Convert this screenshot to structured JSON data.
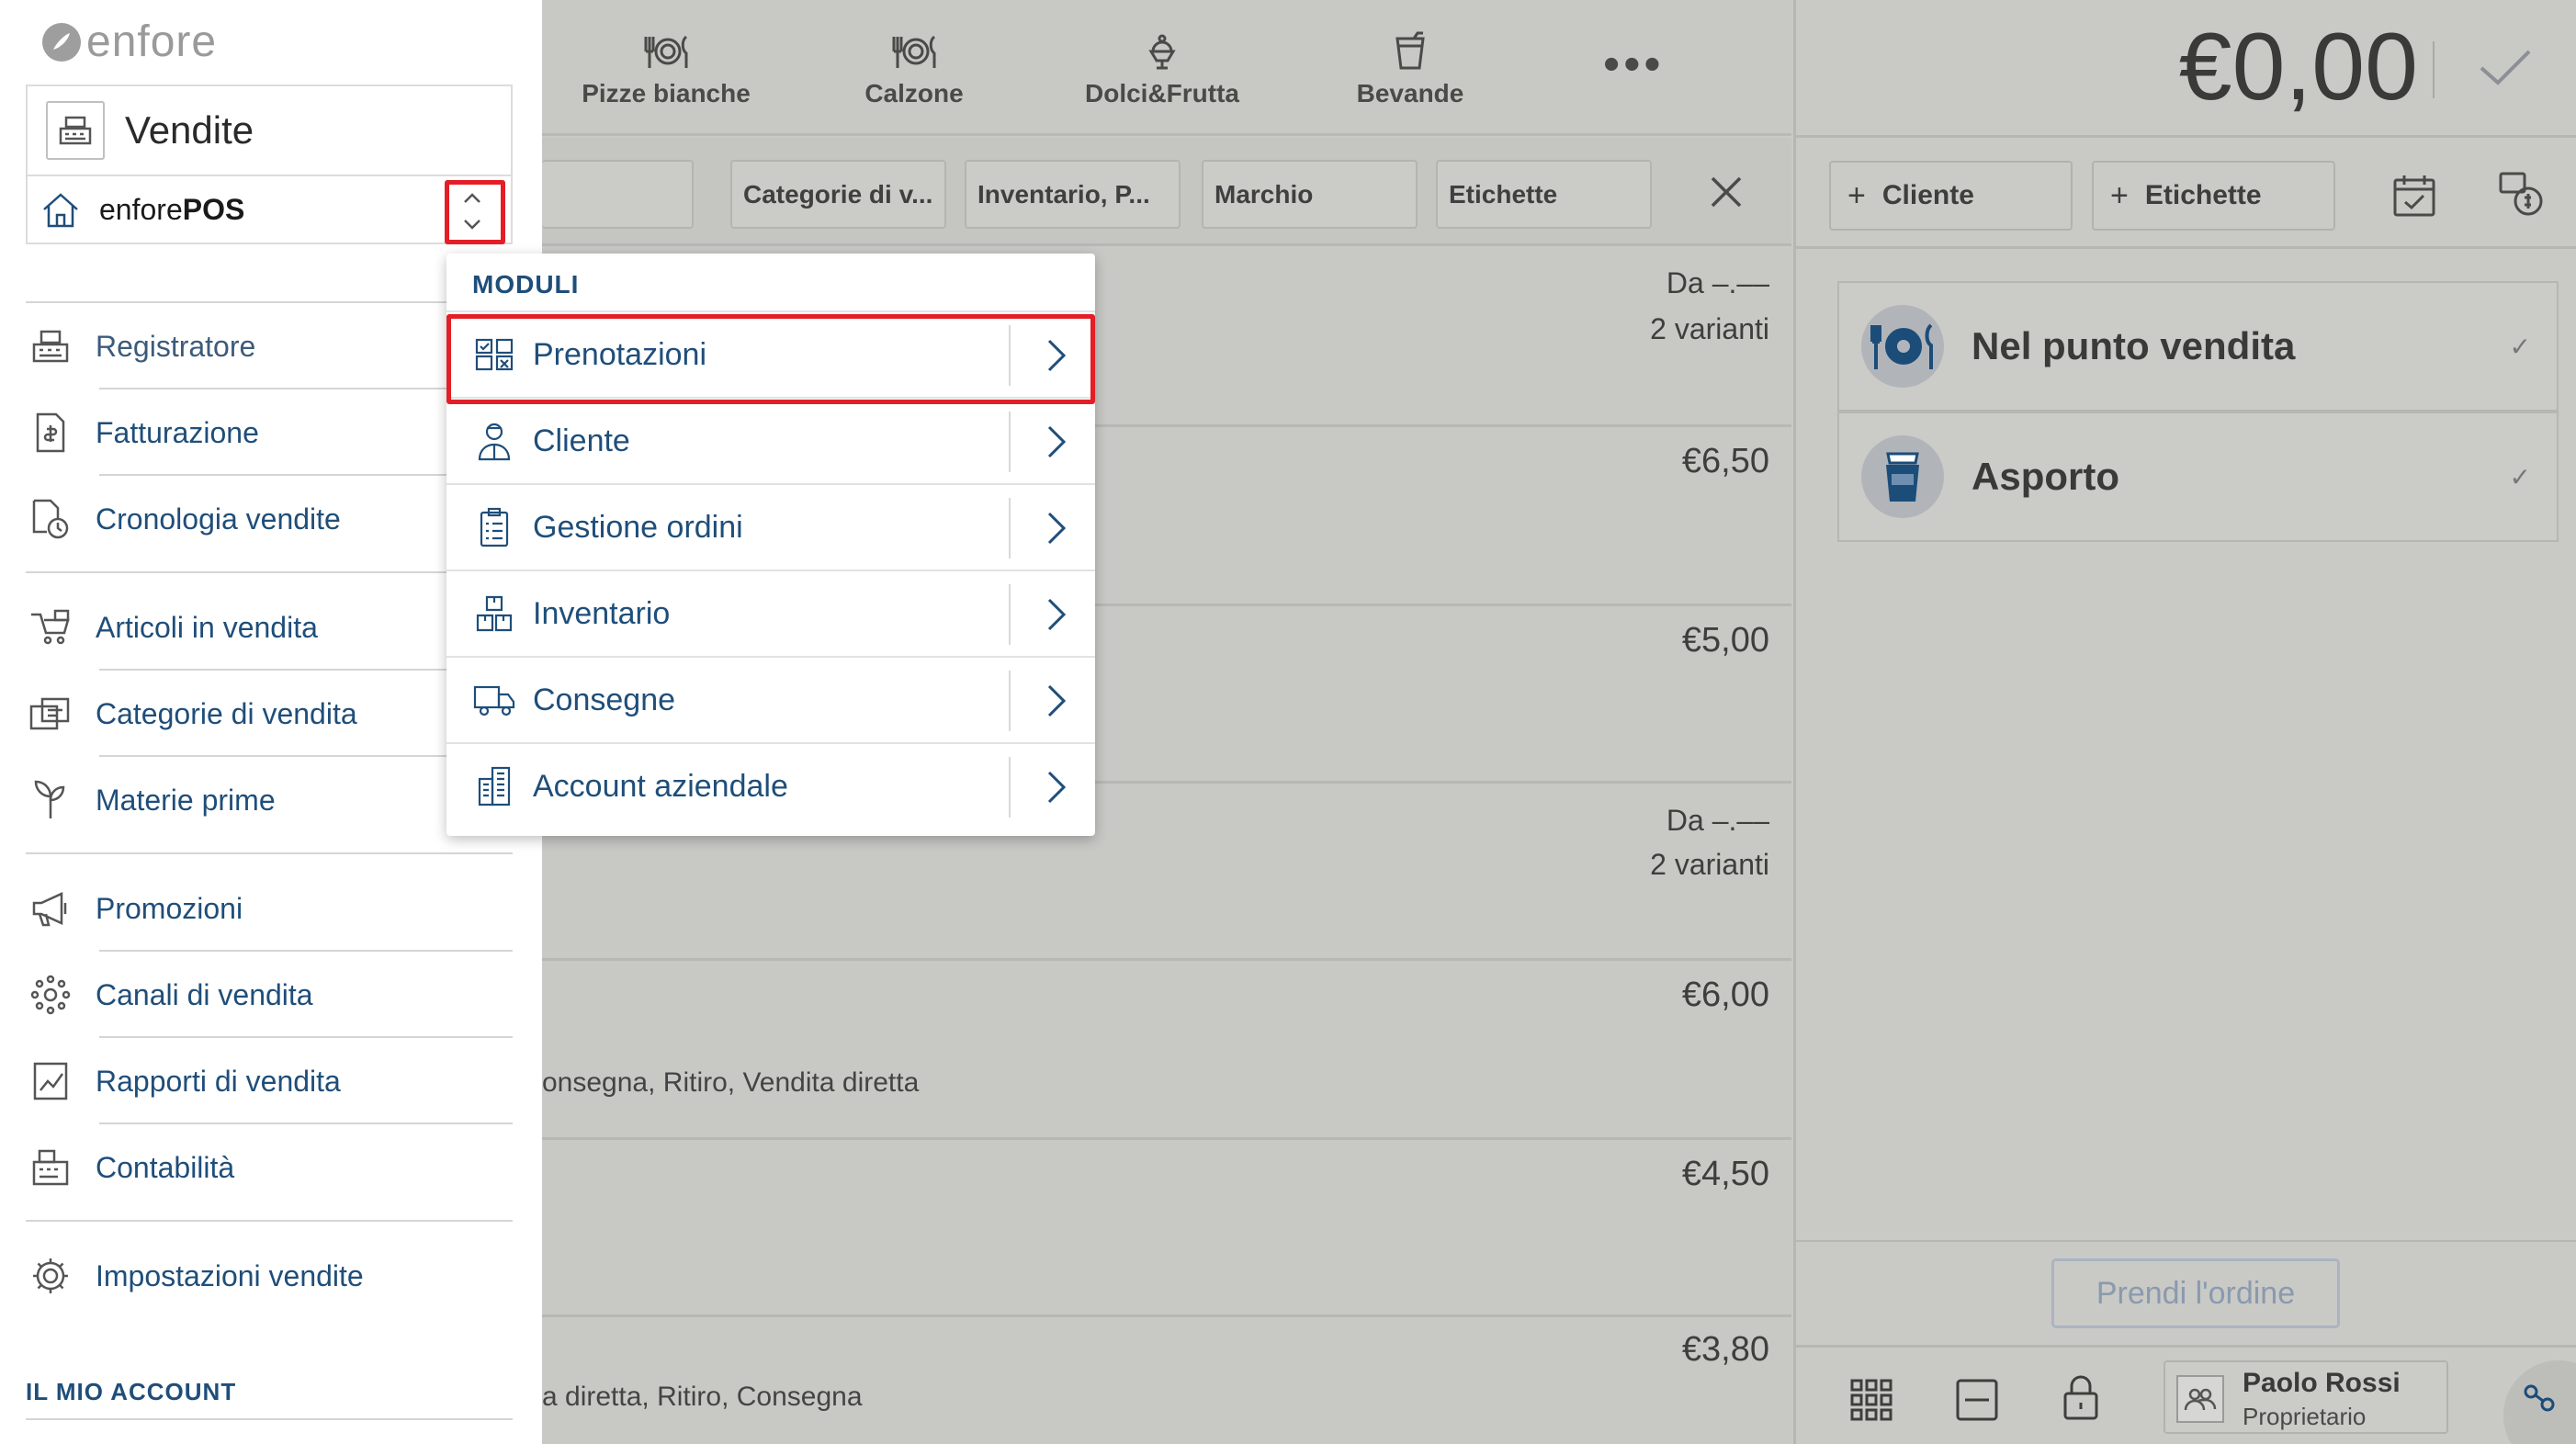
{
  "app": {
    "logo_text": "enfore"
  },
  "sidebar": {
    "section_title": "Vendite",
    "store_selector": {
      "prefix": "enfore",
      "suffix": "POS"
    },
    "items": [
      {
        "label": "Registratore",
        "icon": "cash-register-icon"
      },
      {
        "label": "Fatturazione",
        "icon": "invoice-icon"
      },
      {
        "label": "Cronologia vendite",
        "icon": "sales-history-icon"
      },
      {
        "label": "Articoli in vendita",
        "icon": "products-icon"
      },
      {
        "label": "Categorie di vendita",
        "icon": "categories-icon"
      },
      {
        "label": "Materie prime",
        "icon": "raw-materials-icon"
      },
      {
        "label": "Promozioni",
        "icon": "megaphone-icon"
      },
      {
        "label": "Canali di vendita",
        "icon": "sales-channels-icon"
      },
      {
        "label": "Rapporti di vendita",
        "icon": "reports-chart-icon"
      },
      {
        "label": "Contabilità",
        "icon": "accounting-icon"
      },
      {
        "label": "Impostazioni vendite",
        "icon": "gear-icon"
      }
    ],
    "account_header": "IL MIO ACCOUNT"
  },
  "modules_menu": {
    "header": "MODULI",
    "items": [
      {
        "label": "Prenotazioni",
        "icon": "reservations-icon"
      },
      {
        "label": "Cliente",
        "icon": "customer-icon"
      },
      {
        "label": "Gestione ordini",
        "icon": "order-clipboard-icon"
      },
      {
        "label": "Inventario",
        "icon": "inventory-boxes-icon"
      },
      {
        "label": "Consegne",
        "icon": "delivery-truck-icon"
      },
      {
        "label": "Account aziendale",
        "icon": "business-building-icon"
      }
    ]
  },
  "category_tabs": [
    {
      "label": "Pizze bianche",
      "icon": "plate-cutlery-icon"
    },
    {
      "label": "Calzone",
      "icon": "plate-cutlery-icon"
    },
    {
      "label": "Dolci&Frutta",
      "icon": "ice-cream-icon"
    },
    {
      "label": "Bevande",
      "icon": "drink-cup-icon"
    }
  ],
  "more_label": "•••",
  "filters": [
    "Categorie di v...",
    "Inventario, P...",
    "Marchio",
    "Etichette"
  ],
  "products": [
    {
      "price": "Da –.––",
      "sub": "2 varianti",
      "meta": ""
    },
    {
      "price": "€6,50",
      "sub": "",
      "meta": ""
    },
    {
      "price": "€5,00",
      "sub": "",
      "meta": ""
    },
    {
      "price": "Da –.––",
      "sub": "2 varianti",
      "meta": ""
    },
    {
      "price": "€6,00",
      "sub": "",
      "meta": "onsegna, Ritiro, Vendita diretta"
    },
    {
      "price": "€4,50",
      "sub": "",
      "meta": ""
    },
    {
      "price": "€3,80",
      "sub": "",
      "meta": "a diretta, Ritiro, Consegna"
    }
  ],
  "cart": {
    "total": "€0,00",
    "customer_button": "Cliente",
    "labels_button": "Etichette",
    "order_types": [
      {
        "label": "Nel punto vendita",
        "icon": "dine-in-plate-icon"
      },
      {
        "label": "Asporto",
        "icon": "takeaway-cup-icon"
      }
    ],
    "take_order_button": "Prendi l'ordine",
    "user": {
      "name": "Paolo Rossi",
      "role": "Proprietario"
    }
  },
  "colors": {
    "accent": "#1f4e7a",
    "highlight": "#e41e26",
    "overlay": "#c9c9c6"
  }
}
